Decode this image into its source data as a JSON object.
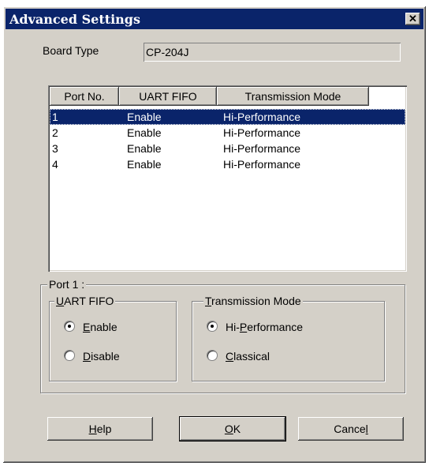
{
  "window": {
    "title": "Advanced Settings",
    "close_glyph": "✕"
  },
  "board": {
    "label": "Board Type",
    "value": "CP-204J"
  },
  "ports_table": {
    "columns": [
      "Port No.",
      "UART FIFO",
      "Transmission Mode"
    ],
    "rows": [
      {
        "port": "1",
        "fifo": "Enable",
        "mode": "Hi-Performance",
        "selected": true
      },
      {
        "port": "2",
        "fifo": "Enable",
        "mode": "Hi-Performance",
        "selected": false
      },
      {
        "port": "3",
        "fifo": "Enable",
        "mode": "Hi-Performance",
        "selected": false
      },
      {
        "port": "4",
        "fifo": "Enable",
        "mode": "Hi-Performance",
        "selected": false
      }
    ]
  },
  "port_group": {
    "title": "Port 1 :",
    "uart_fifo": {
      "title_underlined": "U",
      "title_rest": "ART FIFO",
      "enable": {
        "u": "E",
        "rest": "nable",
        "checked": true
      },
      "disable": {
        "u": "D",
        "rest": "isable",
        "checked": false
      }
    },
    "transmission": {
      "title_underlined": "T",
      "title_rest": "ransmission Mode",
      "hiperf": {
        "pre": "Hi-",
        "u": "P",
        "rest": "erformance",
        "checked": true
      },
      "classical": {
        "pre": "",
        "u": "C",
        "rest": "lassical",
        "checked": false
      }
    }
  },
  "buttons": {
    "help": {
      "u": "H",
      "rest": "elp"
    },
    "ok": {
      "u": "O",
      "rest": "K"
    },
    "cancel": {
      "pre": "Cance",
      "u": "l"
    }
  },
  "colors": {
    "face": "#d4d0c8",
    "title_bar": "#0a246a",
    "selection": "#0a246a"
  }
}
